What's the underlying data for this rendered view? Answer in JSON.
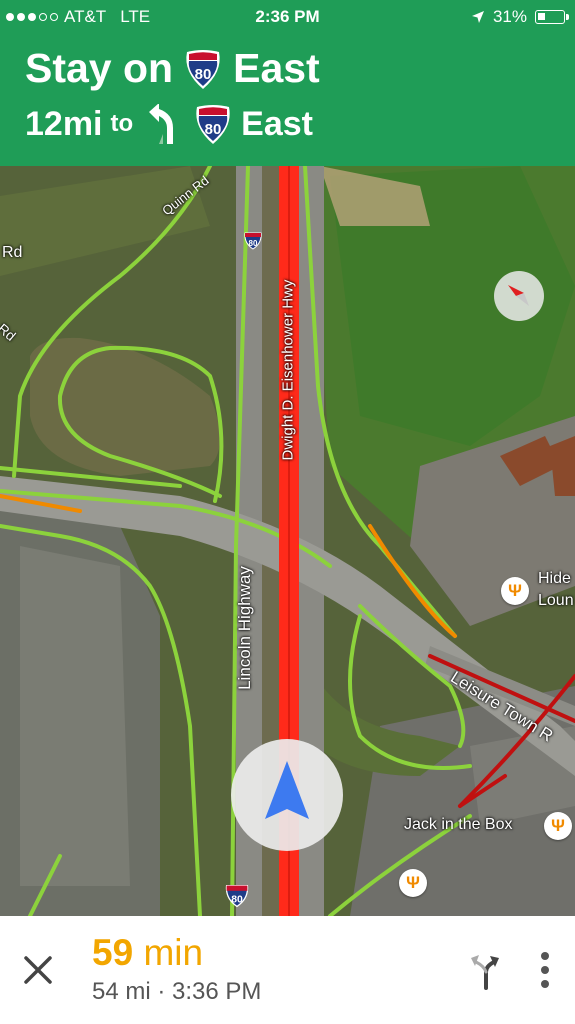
{
  "status_bar": {
    "carrier": "AT&T",
    "network": "LTE",
    "time": "2:36 PM",
    "battery": "31%",
    "battery_level": 0.31,
    "signal_bars": 3
  },
  "navigation": {
    "line1_prefix": "Stay on",
    "line1_highway": "80",
    "line1_direction": "East",
    "line2_distance": "12mi",
    "line2_to": "to",
    "line2_highway": "80",
    "line2_direction": "East"
  },
  "map": {
    "road_labels": {
      "quinn_rd": "Quinn Rd",
      "rd_left": "Rd",
      "rd_left2": "Rd",
      "eisenhower_hwy": "Dwight D. Eisenhower Hwy",
      "lincoln_highway": "Lincoln Highway",
      "leisure_town": "Leisure Town R"
    },
    "shields": {
      "top": "80",
      "bottom": "80"
    },
    "pois": {
      "hide_line1": "Hide",
      "hide_line2": "Loun",
      "jack_in_the_box": "Jack in the Box"
    },
    "colors": {
      "route": "#ff2a1a",
      "traffic_green": "#8cd23c",
      "traffic_orange": "#f08a00",
      "traffic_red": "#c01010",
      "header_green": "#1f9d57",
      "eta_orange": "#f2a600"
    }
  },
  "bottom_bar": {
    "eta_minutes": "59",
    "eta_unit": "min",
    "distance": "54 mi",
    "separator": "·",
    "arrival_time": "3:36 PM"
  }
}
